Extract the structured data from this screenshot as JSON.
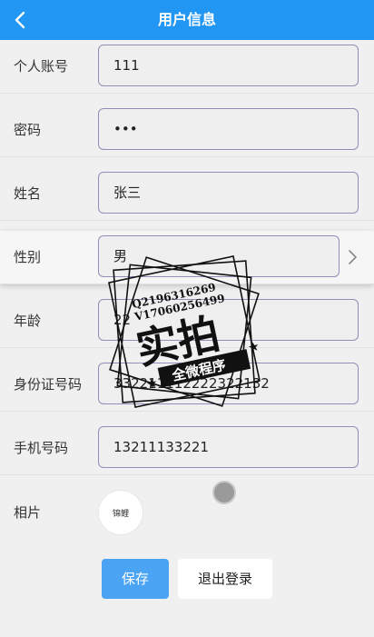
{
  "header": {
    "title": "用户信息",
    "back_icon": "chevron-left-icon",
    "background": "#2196f3"
  },
  "fields": {
    "account": {
      "label": "个人账号",
      "value": "111"
    },
    "password": {
      "label": "密码",
      "value": "•••"
    },
    "name": {
      "label": "姓名",
      "value": "张三"
    },
    "gender": {
      "label": "性别",
      "value": "男"
    },
    "age": {
      "label": "年龄",
      "value": "22"
    },
    "id_number": {
      "label": "身份证号码",
      "value": "332211112222322132"
    },
    "phone": {
      "label": "手机号码",
      "value": "13211133221"
    },
    "photo": {
      "label": "相片",
      "avatar_text": "锦鲤"
    }
  },
  "actions": {
    "save_label": "保存",
    "logout_label": "退出登录",
    "save_color": "#4aa3f3"
  },
  "watermark": {
    "line1": "Q2196316269",
    "line2": "V17060256499",
    "big": "实拍",
    "small": "全微程序"
  }
}
